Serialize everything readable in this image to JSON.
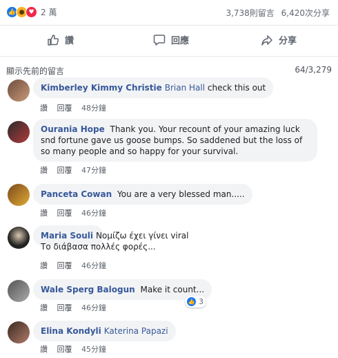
{
  "reactions": {
    "count": "2 萬"
  },
  "stats": {
    "comments": "3,738則留言",
    "shares": "6,420次分享"
  },
  "actions": {
    "like": "讚",
    "comment": "回應",
    "share": "分享"
  },
  "previous": {
    "label": "顯示先前的留言",
    "count": "64/3,279"
  },
  "meta_labels": {
    "like": "讚",
    "reply": "回覆"
  },
  "comments": [
    {
      "name": "Kimberley Kimmy Christie",
      "tag": "Brian Hall",
      "text": "check this out",
      "time": "48分鐘"
    },
    {
      "name": "Ourania Hope",
      "text": "Thank you. Your recount of your amazing luck snd fortune gave us goose bumps. So saddened but the loss of so many people and so happy for your survival.",
      "time": "47分鐘"
    },
    {
      "name": "Panceta Cowan",
      "text": "You are a very blessed man.....",
      "time": "46分鐘"
    },
    {
      "name": "Maria Souli",
      "text": "Νομίζω έχει γίνει viral Το διάβασα πολλές φορές...",
      "time": "46分鐘"
    },
    {
      "name": "Wale Sperg Balogun",
      "text": "Make it count...",
      "time": "46分鐘",
      "reactions": "3"
    },
    {
      "name": "Elina Kondyli",
      "tag": "Katerina Papazi",
      "time": "45分鐘"
    }
  ],
  "colors": {
    "accent": "#365899",
    "like": "#1877f2",
    "love": "#f0284a",
    "wow": "#f7b125"
  }
}
